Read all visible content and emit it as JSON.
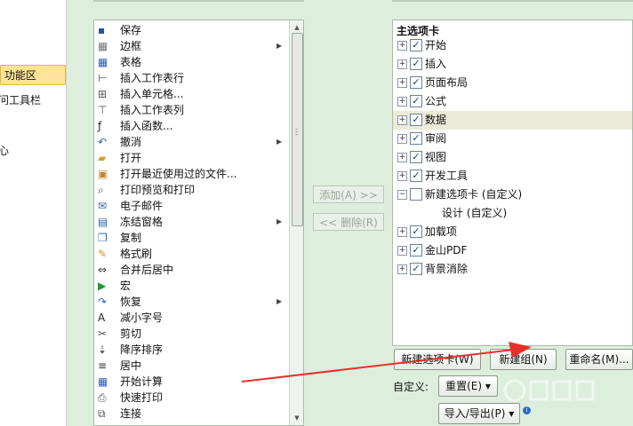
{
  "left_nav": {
    "items": [
      {
        "label": "功能区",
        "selected": true
      },
      {
        "label": "问工具栏",
        "selected": false
      },
      {
        "label": "心",
        "selected": false
      }
    ]
  },
  "commands": [
    {
      "label": "保存",
      "icon": "save-icon",
      "submenu": false
    },
    {
      "label": "边框",
      "icon": "border-icon",
      "submenu": true
    },
    {
      "label": "表格",
      "icon": "table-icon",
      "submenu": false
    },
    {
      "label": "插入工作表行",
      "icon": "insert-row-icon",
      "submenu": false
    },
    {
      "label": "插入单元格...",
      "icon": "insert-cell-icon",
      "submenu": false
    },
    {
      "label": "插入工作表列",
      "icon": "insert-column-icon",
      "submenu": false
    },
    {
      "label": "插入函数...",
      "icon": "function-icon",
      "submenu": false
    },
    {
      "label": "撤消",
      "icon": "undo-icon",
      "submenu": true
    },
    {
      "label": "打开",
      "icon": "open-folder-icon",
      "submenu": false
    },
    {
      "label": "打开最近使用过的文件...",
      "icon": "recent-file-icon",
      "submenu": false
    },
    {
      "label": "打印预览和打印",
      "icon": "print-preview-icon",
      "submenu": false
    },
    {
      "label": "电子邮件",
      "icon": "email-icon",
      "submenu": false
    },
    {
      "label": "冻结窗格",
      "icon": "freeze-panes-icon",
      "submenu": true
    },
    {
      "label": "复制",
      "icon": "copy-icon",
      "submenu": false
    },
    {
      "label": "格式刷",
      "icon": "format-painter-icon",
      "submenu": false
    },
    {
      "label": "合并后居中",
      "icon": "merge-center-icon",
      "submenu": false
    },
    {
      "label": "宏",
      "icon": "macro-icon",
      "submenu": false
    },
    {
      "label": "恢复",
      "icon": "redo-icon",
      "submenu": true
    },
    {
      "label": "减小字号",
      "icon": "decrease-font-icon",
      "submenu": false
    },
    {
      "label": "剪切",
      "icon": "cut-icon",
      "submenu": false
    },
    {
      "label": "降序排序",
      "icon": "sort-desc-icon",
      "submenu": false
    },
    {
      "label": "居中",
      "icon": "align-center-icon",
      "submenu": false
    },
    {
      "label": "开始计算",
      "icon": "calculate-icon",
      "submenu": false
    },
    {
      "label": "快速打印",
      "icon": "quick-print-icon",
      "submenu": false
    },
    {
      "label": "连接",
      "icon": "connection-icon",
      "submenu": false
    }
  ],
  "buttons": {
    "add": "添加(A) >>",
    "remove": "<< 删除(R)",
    "new_tab": "新建选项卡(W)",
    "new_group": "新建组(N)",
    "rename": "重命名(M)...",
    "customize_label": "自定义:",
    "reset": "重置(E) ▾",
    "import_export": "导入/导出(P) ▾"
  },
  "tree": {
    "header": "主选项卡",
    "items": [
      {
        "label": "开始",
        "expander": "+",
        "checked": true,
        "highlight": false,
        "sub": false
      },
      {
        "label": "插入",
        "expander": "+",
        "checked": true,
        "highlight": false,
        "sub": false
      },
      {
        "label": "页面布局",
        "expander": "+",
        "checked": true,
        "highlight": false,
        "sub": false
      },
      {
        "label": "公式",
        "expander": "+",
        "checked": true,
        "highlight": false,
        "sub": false
      },
      {
        "label": "数据",
        "expander": "+",
        "checked": true,
        "highlight": true,
        "sub": false
      },
      {
        "label": "审阅",
        "expander": "+",
        "checked": true,
        "highlight": false,
        "sub": false
      },
      {
        "label": "视图",
        "expander": "+",
        "checked": true,
        "highlight": false,
        "sub": false
      },
      {
        "label": "开发工具",
        "expander": "+",
        "checked": true,
        "highlight": false,
        "sub": false
      },
      {
        "label": "新建选项卡 (自定义)",
        "expander": "−",
        "checked": false,
        "highlight": false,
        "sub": false
      },
      {
        "label": "设计 (自定义)",
        "expander": "",
        "checked": null,
        "highlight": false,
        "sub": true
      },
      {
        "label": "加载项",
        "expander": "+",
        "checked": true,
        "highlight": false,
        "sub": false
      },
      {
        "label": "金山PDF",
        "expander": "+",
        "checked": true,
        "highlight": false,
        "sub": false
      },
      {
        "label": "背景消除",
        "expander": "+",
        "checked": true,
        "highlight": false,
        "sub": false
      }
    ]
  },
  "colors": {
    "background": "#ddeedd",
    "annotation_arrow": "#e8302a",
    "selected_nav": "#ffe39a"
  }
}
